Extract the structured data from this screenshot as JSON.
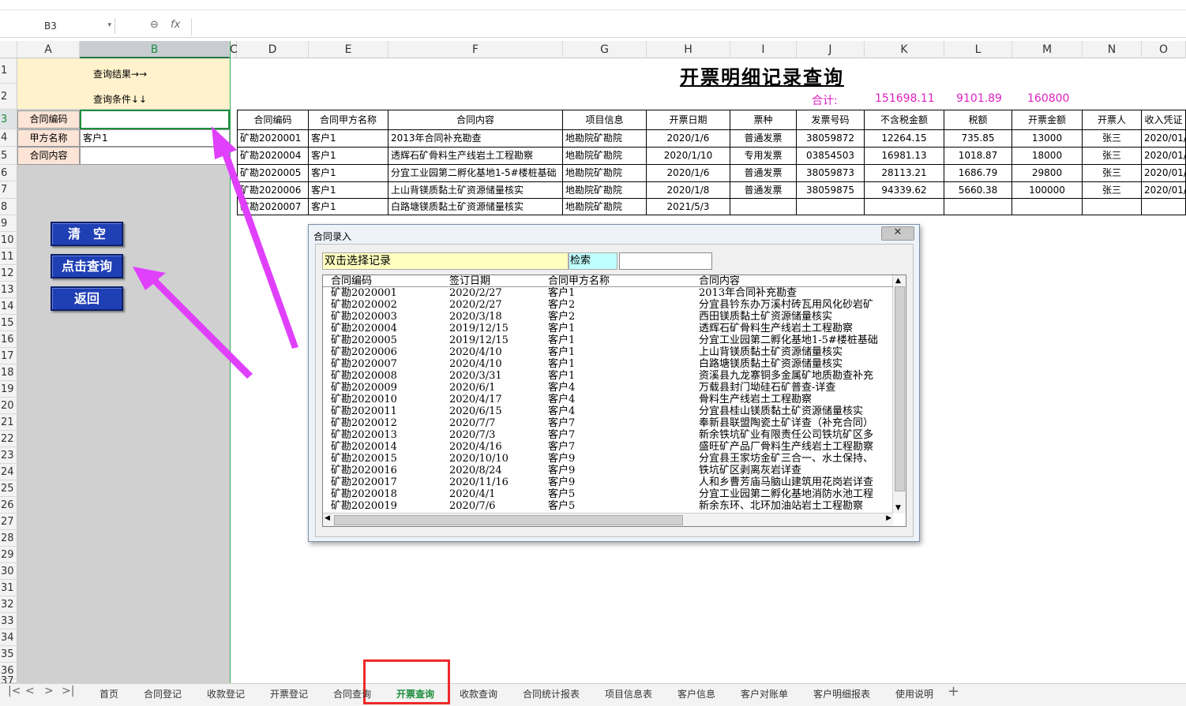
{
  "namebox": {
    "value": "B3"
  },
  "formula": {
    "fx": "fx",
    "value": ""
  },
  "columns": [
    "A",
    "B",
    "C",
    "D",
    "E",
    "F",
    "G",
    "H",
    "I",
    "J",
    "K",
    "L",
    "M",
    "N",
    "O"
  ],
  "rows": [
    "1",
    "2",
    "3",
    "4",
    "5",
    "6",
    "7",
    "8",
    "9",
    "10",
    "11",
    "12",
    "13",
    "14",
    "15",
    "16",
    "17",
    "18",
    "19",
    "20",
    "21",
    "22",
    "23",
    "24",
    "25",
    "26",
    "27",
    "28",
    "29",
    "30",
    "31",
    "32",
    "33",
    "34",
    "35",
    "36",
    "37"
  ],
  "left_panel": {
    "result_label": "查询结果→→",
    "condition_label": "查询条件↓↓",
    "contract_code_label": "合同编码",
    "contract_code_value": "",
    "party_label": "甲方名称",
    "party_value": "客户1",
    "content_label": "合同内容",
    "content_value": ""
  },
  "buttons": {
    "clear": "清　空",
    "query": "点击查询",
    "back": "返回"
  },
  "report": {
    "title": "开票明细记录查询",
    "sum_label": "合计:",
    "sum_pretax": "151698.11",
    "sum_tax": "9101.89",
    "sum_amount": "160800",
    "headers": [
      "合同编码",
      "合同甲方名称",
      "合同内容",
      "项目信息",
      "开票日期",
      "票种",
      "发票号码",
      "不含税金额",
      "税额",
      "开票金额",
      "开票人",
      "收入凭证"
    ],
    "rows": [
      [
        "矿勘2020001",
        "客户1",
        "2013年合同补充勘查",
        "地勘院矿勘院",
        "2020/1/6",
        "普通发票",
        "38059872",
        "12264.15",
        "735.85",
        "13000",
        "张三",
        "2020/01/"
      ],
      [
        "矿勘2020004",
        "客户1",
        "透辉石矿骨料生产线岩土工程勘察",
        "地勘院矿勘院",
        "2020/1/10",
        "专用发票",
        "03854503",
        "16981.13",
        "1018.87",
        "18000",
        "张三",
        "2020/01/"
      ],
      [
        "矿勘2020005",
        "客户1",
        "分宜工业园第二孵化基地1-5#楼桩基础",
        "地勘院矿勘院",
        "2020/1/6",
        "普通发票",
        "38059873",
        "28113.21",
        "1686.79",
        "29800",
        "张三",
        "2020/01/"
      ],
      [
        "矿勘2020006",
        "客户1",
        "上山背镁质黏土矿资源储量核实",
        "地勘院矿勘院",
        "2020/1/8",
        "普通发票",
        "38059875",
        "94339.62",
        "5660.38",
        "100000",
        "张三",
        "2020/01/"
      ],
      [
        "矿勘2020007",
        "客户1",
        "白路塘镁质黏土矿资源储量核实",
        "地勘院矿勘院",
        "2021/5/3",
        "",
        "",
        "",
        "",
        "",
        "",
        ""
      ]
    ]
  },
  "dialog": {
    "title": "合同录入",
    "close": "✕",
    "hint": "双击选择记录",
    "search_label": "检索",
    "search_value": "",
    "list_headers": [
      "合同编码",
      "签订日期",
      "合同甲方名称",
      "合同内容"
    ],
    "list_rows": [
      [
        "矿勘2020001",
        "2020/2/27",
        "客户1",
        "2013年合同补充勘查"
      ],
      [
        "矿勘2020002",
        "2020/2/27",
        "客户2",
        "分宜县钤东办万溪村砖瓦用风化砂岩矿"
      ],
      [
        "矿勘2020003",
        "2020/3/18",
        "客户2",
        "西田镁质黏土矿资源储量核实"
      ],
      [
        "矿勘2020004",
        "2019/12/15",
        "客户1",
        "透辉石矿骨料生产线岩土工程勘察"
      ],
      [
        "矿勘2020005",
        "2019/12/15",
        "客户1",
        "分宜工业园第二孵化基地1-5#楼桩基础"
      ],
      [
        "矿勘2020006",
        "2020/4/10",
        "客户1",
        "上山背镁质黏土矿资源储量核实"
      ],
      [
        "矿勘2020007",
        "2020/4/10",
        "客户1",
        "白路塘镁质黏土矿资源储量核实"
      ],
      [
        "矿勘2020008",
        "2020/3/31",
        "客户1",
        "资溪县九龙寨铜多金属矿地质勘查补充"
      ],
      [
        "矿勘2020009",
        "2020/6/1",
        "客户4",
        "万载县封门坳硅石矿普查-详查"
      ],
      [
        "矿勘2020010",
        "2020/4/17",
        "客户4",
        "骨料生产线岩土工程勘察"
      ],
      [
        "矿勘2020011",
        "2020/6/15",
        "客户4",
        "分宜县桂山镁质黏土矿资源储量核实"
      ],
      [
        "矿勘2020012",
        "2020/7/7",
        "客户7",
        "奉新县联盟陶瓷土矿详查（补充合同）"
      ],
      [
        "矿勘2020013",
        "2020/7/3",
        "客户7",
        "新余铁坑矿业有限责任公司铁坑矿区多"
      ],
      [
        "矿勘2020014",
        "2020/4/16",
        "客户7",
        "盛旺矿产品厂骨料生产线岩土工程勘察"
      ],
      [
        "矿勘2020015",
        "2020/10/10",
        "客户9",
        "分宜县王家坊金矿三合一、水土保持、"
      ],
      [
        "矿勘2020016",
        "2020/8/24",
        "客户9",
        "铁坑矿区剥离灰岩详查"
      ],
      [
        "矿勘2020017",
        "2020/11/16",
        "客户9",
        "人和乡曹芳庙马脑山建筑用花岗岩详查"
      ],
      [
        "矿勘2020018",
        "2020/4/1",
        "客户5",
        "分宜工业园第二孵化基地消防水池工程"
      ],
      [
        "矿勘2020019",
        "2020/7/6",
        "客户5",
        "新余东环、北环加油站岩土工程勘察"
      ]
    ]
  },
  "tabs": [
    "首页",
    "合同登记",
    "收款登记",
    "开票登记",
    "合同查询",
    "开票查询",
    "收款查询",
    "合同统计报表",
    "项目信息表",
    "客户信息",
    "客户对账单",
    "客户明细报表",
    "使用说明"
  ],
  "active_tab": "开票查询",
  "add_tab": "+",
  "colors": {
    "accent_green": "#1e8e3e",
    "button_blue": "#1f3fb5",
    "annotation_magenta": "#e040fb",
    "sum_color": "#e020c0"
  }
}
